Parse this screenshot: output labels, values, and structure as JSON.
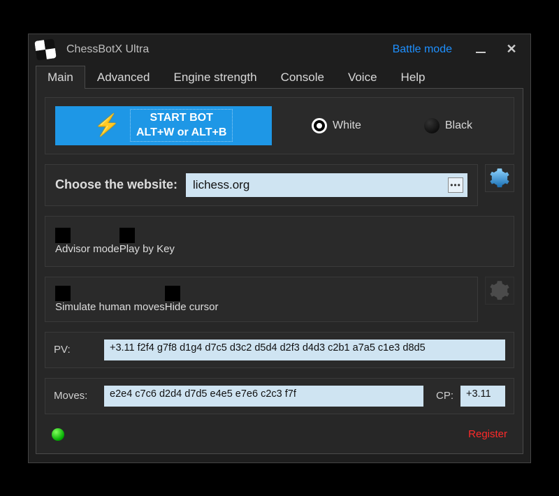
{
  "window": {
    "title": "ChessBotX Ultra",
    "mode_label": "Battle mode"
  },
  "tabs": [
    "Main",
    "Advanced",
    "Engine strength",
    "Console",
    "Voice",
    "Help"
  ],
  "start": {
    "line1": "START BOT",
    "line2": "ALT+W or ALT+B"
  },
  "color": {
    "white_label": "White",
    "black_label": "Black",
    "selected": "white"
  },
  "website": {
    "label": "Choose the website:",
    "value": "lichess.org"
  },
  "checks": {
    "advisor": "Advisor mode",
    "play_by_key": "Play by Key",
    "simulate_human": "Simulate human moves",
    "hide_cursor": "Hide cursor"
  },
  "pv": {
    "label": "PV:",
    "value": "+3.11  f2f4 g7f8 d1g4 d7c5 d3c2 d5d4 d2f3 d4d3 c2b1 a7a5 c1e3 d8d5"
  },
  "moves": {
    "label": "Moves:",
    "value": "e2e4 c7c6 d2d4 d7d5 e4e5 e7e6 c2c3 f7f"
  },
  "cp": {
    "label": "CP:",
    "value": "+3.11"
  },
  "status": {
    "register": "Register"
  }
}
